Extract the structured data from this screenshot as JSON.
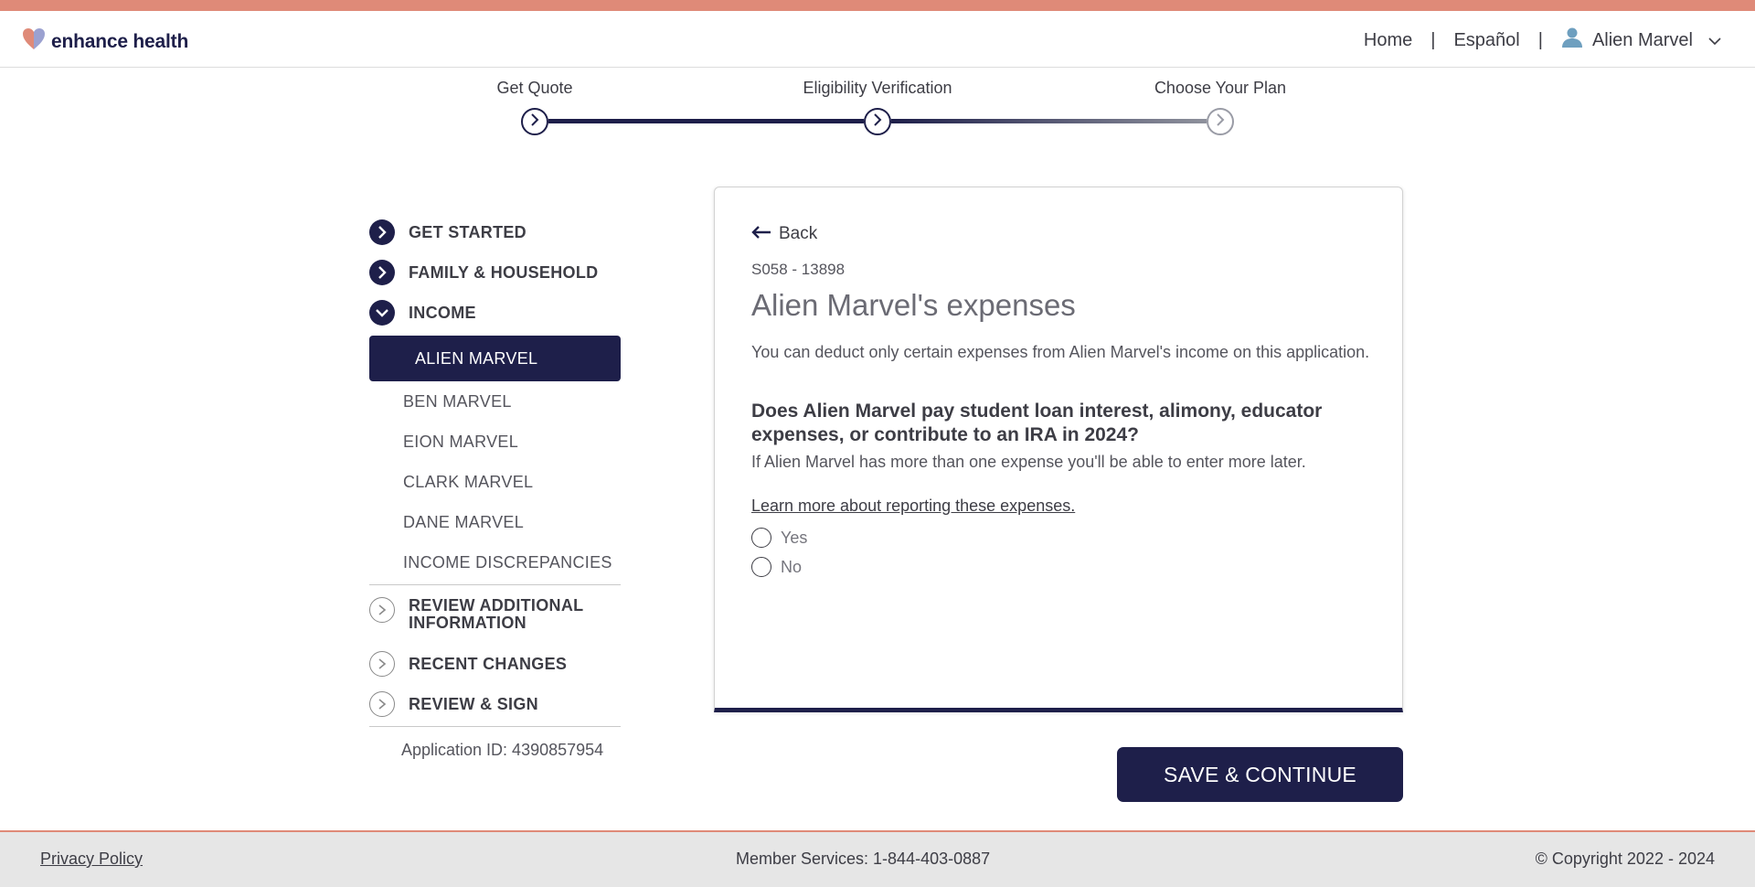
{
  "brand": {
    "name": "enhance health",
    "accent": "#df8a78",
    "navy": "#1e1f4a"
  },
  "header": {
    "nav": {
      "home": "Home",
      "sep": "|",
      "language": "Español",
      "user": "Alien Marvel"
    }
  },
  "progress": {
    "steps": [
      {
        "label": "Get Quote",
        "state": "complete"
      },
      {
        "label": "Eligibility Verification",
        "state": "current"
      },
      {
        "label": "Choose Your Plan",
        "state": "upcoming"
      }
    ]
  },
  "sidebar": {
    "sections_top": [
      {
        "label": "GET STARTED",
        "icon": "chevron-right-icon",
        "state": "complete"
      },
      {
        "label": "FAMILY & HOUSEHOLD",
        "icon": "chevron-right-icon",
        "state": "complete"
      },
      {
        "label": "INCOME",
        "icon": "chevron-down-icon",
        "state": "expanded"
      }
    ],
    "income_items": [
      {
        "label": "ALIEN MARVEL",
        "active": true
      },
      {
        "label": "BEN MARVEL"
      },
      {
        "label": "EION MARVEL"
      },
      {
        "label": "CLARK MARVEL"
      },
      {
        "label": "DANE MARVEL"
      },
      {
        "label": "INCOME DISCREPANCIES"
      }
    ],
    "sections_bottom": [
      {
        "label_line1": "REVIEW ADDITIONAL",
        "label_line2": "INFORMATION"
      },
      {
        "label": "RECENT CHANGES"
      },
      {
        "label": "REVIEW & SIGN"
      }
    ],
    "application_id": "Application ID: 4390857954"
  },
  "card": {
    "back": "Back",
    "code": "S058 - 13898",
    "title": "Alien Marvel's expenses",
    "description": "You can deduct only certain expenses from Alien Marvel's income on this application.",
    "question": "Does Alien Marvel pay student loan interest, alimony, educator expenses, or contribute to an IRA in 2024?",
    "hint": "If Alien Marvel has more than one expense you'll be able to enter more later.",
    "learn_link": "Learn more about reporting these expenses.",
    "options": {
      "yes": "Yes",
      "no": "No"
    }
  },
  "actions": {
    "save": "SAVE & CONTINUE"
  },
  "footer": {
    "privacy": "Privacy Policy",
    "phone": "Member Services: 1-844-403-0887",
    "copyright": "© Copyright 2022 - 2024"
  }
}
